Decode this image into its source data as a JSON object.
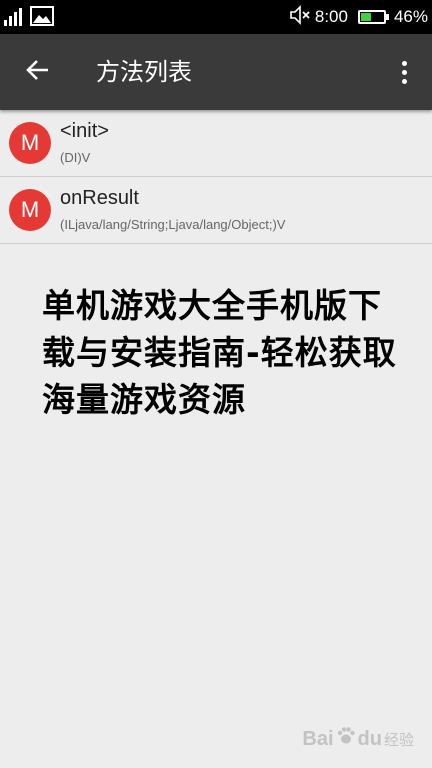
{
  "status_bar": {
    "time": "8:00",
    "battery_percent": "46%",
    "battery_level": 0.46,
    "icons": [
      "signal-icon",
      "image-notification-icon",
      "mute-icon",
      "battery-icon"
    ]
  },
  "app_bar": {
    "title": "方法列表",
    "back_icon": "back-arrow-icon",
    "menu_icon": "overflow-menu-icon"
  },
  "methods": [
    {
      "badge": "M",
      "name": "<init>",
      "signature": "(DI)V"
    },
    {
      "badge": "M",
      "name": "onResult",
      "signature": "(ILjava/lang/String;Ljava/lang/Object;)V"
    }
  ],
  "overlay": {
    "headline": "单机游戏大全手机版下载与安装指南-轻松获取海量游戏资源"
  },
  "watermark": {
    "text": "Bai",
    "suffix": "du",
    "sub": "经验"
  },
  "colors": {
    "status_bar": "#000000",
    "app_bar": "#3a3a3a",
    "badge": "#e53935",
    "background": "#ededed",
    "battery_fill": "#3fd13f"
  }
}
